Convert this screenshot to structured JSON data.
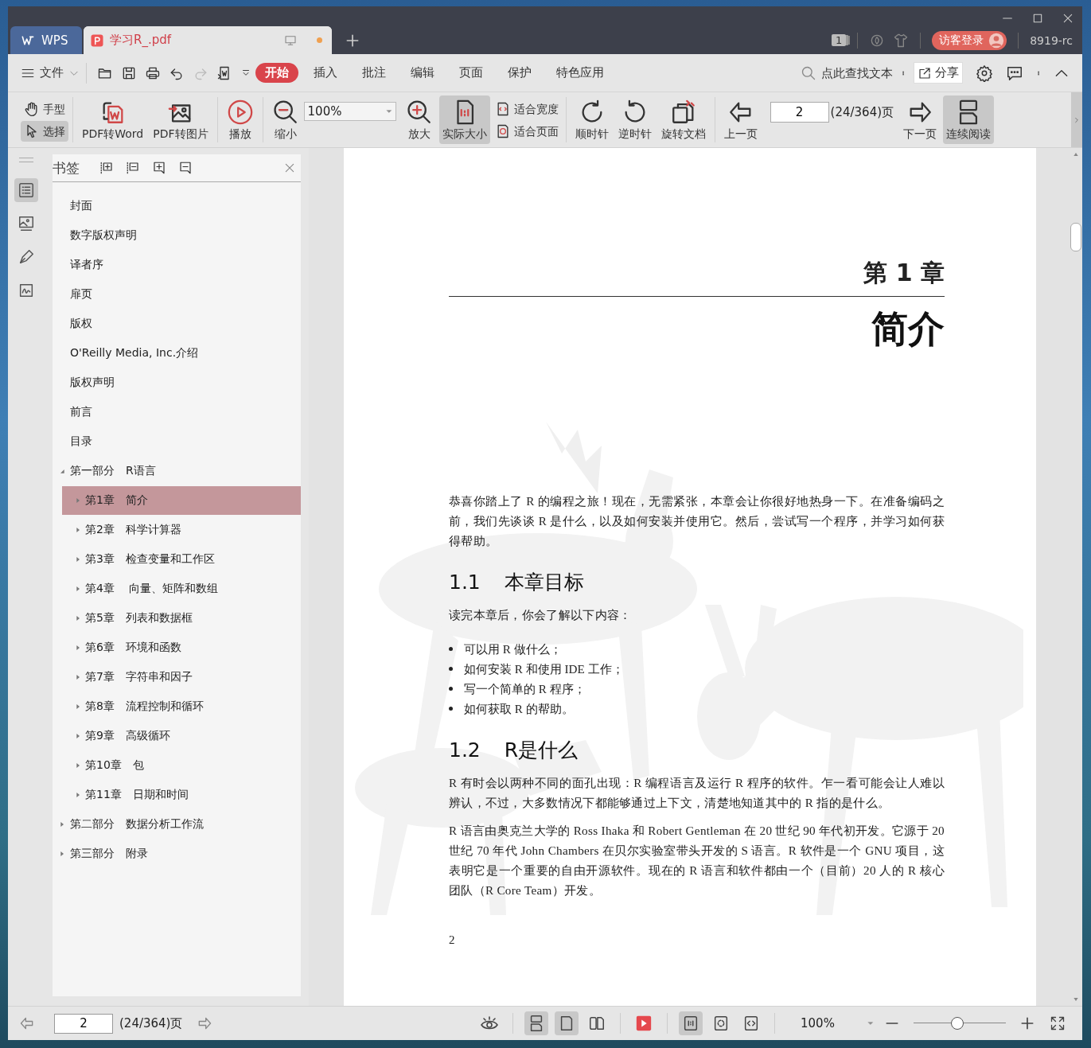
{
  "tabs": [
    {
      "kind": "home",
      "label": "WPS",
      "selected": false
    },
    {
      "kind": "file",
      "label": "学习R_.pdf",
      "selected": true
    }
  ],
  "title_bar": {
    "page_badge": "1",
    "login_button": "访客登录",
    "user": "8919-rc"
  },
  "menu": {
    "file": "文件",
    "quick_actions": [
      {
        "disabled": false
      },
      {
        "disabled": false
      },
      {
        "disabled": false
      },
      {
        "disabled": false
      },
      {
        "disabled": true
      },
      {
        "disabled": false
      }
    ],
    "tabs": [
      {
        "label": "开始",
        "selected": true
      },
      {
        "label": "插入",
        "selected": false
      },
      {
        "label": "批注",
        "selected": false
      },
      {
        "label": "编辑",
        "selected": false
      },
      {
        "label": "页面",
        "selected": false
      },
      {
        "label": "保护",
        "selected": false
      },
      {
        "label": "特色应用",
        "selected": false
      }
    ],
    "search_placeholder": "点此查找文本",
    "share": "分享"
  },
  "toolbar": [
    {
      "kind": "stack",
      "items": [
        {
          "label": "手型",
          "selected": false
        },
        {
          "label": "选择",
          "selected": true
        }
      ]
    },
    {
      "kind": "big",
      "label": "PDF转Word",
      "selected": false
    },
    {
      "kind": "big",
      "label": "PDF转图片",
      "selected": false
    },
    {
      "kind": "big",
      "label": "播放",
      "selected": false
    },
    {
      "kind": "big",
      "label": "缩小",
      "selected": false
    },
    {
      "kind": "zoom",
      "value": "100%"
    },
    {
      "kind": "big",
      "label": "放大",
      "selected": false
    },
    {
      "kind": "big",
      "label": "实际大小",
      "selected": true
    },
    {
      "kind": "stack",
      "items": [
        {
          "label": "适合宽度",
          "selected": false
        },
        {
          "label": "适合页面",
          "selected": false
        }
      ]
    },
    {
      "kind": "big",
      "label": "顺时针",
      "selected": false
    },
    {
      "kind": "big",
      "label": "逆时针",
      "selected": false
    },
    {
      "kind": "big",
      "label": "旋转文档",
      "selected": false
    },
    {
      "kind": "big",
      "label": "上一页",
      "selected": false
    },
    {
      "kind": "page",
      "value": "2",
      "total": "(24/364)页"
    },
    {
      "kind": "big",
      "label": "下一页",
      "selected": false
    },
    {
      "kind": "big",
      "label": "连续阅读",
      "selected": true
    }
  ],
  "rail": [
    {
      "selected": true
    },
    {
      "selected": false
    },
    {
      "selected": false
    },
    {
      "selected": false
    }
  ],
  "sidebar": {
    "title": "书签",
    "items": [
      {
        "label": "封面",
        "selected": false
      },
      {
        "label": "数字版权声明",
        "selected": false
      },
      {
        "label": "译者序",
        "selected": false
      },
      {
        "label": "扉页",
        "selected": false
      },
      {
        "label": "版权",
        "selected": false
      },
      {
        "label": "O'Reilly Media, Inc.介绍",
        "selected": false
      },
      {
        "label": "版权声明",
        "selected": false
      },
      {
        "label": "前言",
        "selected": false
      },
      {
        "label": "目录",
        "selected": false
      },
      {
        "label": "第一部分　R语言",
        "selected": false,
        "expanded": true,
        "children": [
          {
            "label": "第1章　简介",
            "selected": true,
            "expanded": false
          },
          {
            "label": "第2章　科学计算器",
            "selected": false,
            "expanded": false
          },
          {
            "label": "第3章　检查变量和工作区",
            "selected": false,
            "expanded": false
          },
          {
            "label": "第4章　 向量、矩阵和数组",
            "selected": false,
            "expanded": false
          },
          {
            "label": "第5章　列表和数据框",
            "selected": false,
            "expanded": false
          },
          {
            "label": "第6章　环境和函数",
            "selected": false,
            "expanded": false
          },
          {
            "label": "第7章　字符串和因子",
            "selected": false,
            "expanded": false
          },
          {
            "label": "第8章　流程控制和循环",
            "selected": false,
            "expanded": false
          },
          {
            "label": "第9章　高级循环",
            "selected": false,
            "expanded": false
          },
          {
            "label": "第10章　包",
            "selected": false,
            "expanded": false
          },
          {
            "label": "第11章　日期和时间",
            "selected": false,
            "expanded": false
          }
        ]
      },
      {
        "label": "第二部分　数据分析工作流",
        "selected": false,
        "expanded": false
      },
      {
        "label": "第三部分　附录",
        "selected": false,
        "expanded": false
      }
    ]
  },
  "document": {
    "chapter_label": "第 1 章",
    "chapter_title": "简介",
    "blocks": [
      {
        "kind": "paragraph",
        "text": "恭喜你踏上了 R 的编程之旅！现在，无需紧张，本章会让你很好地热身一下。在准备编码之前，我们先谈谈 R 是什么，以及如何安装并使用它。然后，尝试写一个程序，并学习如何获得帮助。"
      },
      {
        "kind": "heading",
        "number": "1.1",
        "text": "本章目标"
      },
      {
        "kind": "paragraph",
        "text": "读完本章后，你会了解以下内容："
      },
      {
        "kind": "bullets",
        "items": [
          "可以用 R 做什么；",
          "如何安装 R 和使用 IDE 工作；",
          "写一个简单的 R 程序；",
          "如何获取 R 的帮助。"
        ]
      },
      {
        "kind": "heading",
        "number": "1.2",
        "text": "R是什么"
      },
      {
        "kind": "paragraph",
        "text": "R 有时会以两种不同的面孔出现：R 编程语言及运行 R 程序的软件。乍一看可能会让人难以辨认，不过，大多数情况下都能够通过上下文，清楚地知道其中的 R 指的是什么。"
      },
      {
        "kind": "paragraph",
        "text": "R 语言由奥克兰大学的 Ross Ihaka 和 Robert Gentleman 在 20 世纪 90 年代初开发。它源于 20 世纪 70 年代 John Chambers 在贝尔实验室带头开发的 S 语言。R 软件是一个 GNU 项目，这表明它是一个重要的自由开源软件。现在的 R 语言和软件都由一个（目前）20 人的 R 核心团队（R Core Team）开发。"
      }
    ],
    "page_number": "2"
  },
  "status_bar": {
    "page_value": "2",
    "page_total": "(24/364)页",
    "view_modes": [
      {
        "selected": true
      },
      {
        "selected": true
      },
      {
        "selected": false
      }
    ],
    "fit_modes": [
      {
        "selected": true
      },
      {
        "selected": false
      },
      {
        "selected": false
      }
    ],
    "zoom": "100%",
    "zoom_slider": {
      "level": 0.47
    }
  }
}
